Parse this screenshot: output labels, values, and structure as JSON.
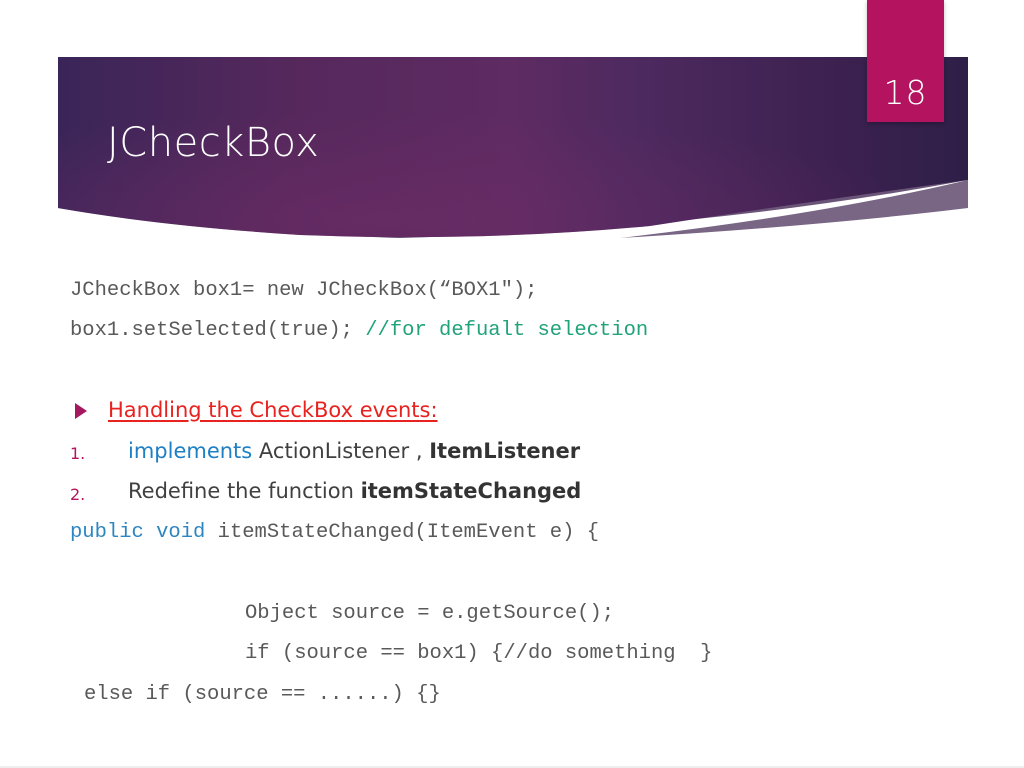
{
  "slide": {
    "number": "18",
    "title": "JCheckBox"
  },
  "code_block_1": {
    "line1": "JCheckBox box1= new JCheckBox(“BOX1\");",
    "line2_code": "box1.setSelected(true); ",
    "line2_comment": "//for defualt selection"
  },
  "section": {
    "heading": "Handling the CheckBox events:",
    "items": [
      {
        "number": "1.",
        "keyword": "implements",
        "text": " ActionListener , ",
        "bold": "ItemListener"
      },
      {
        "number": "2.",
        "text": "Redefine the function ",
        "bold": "itemStateChanged"
      }
    ]
  },
  "code_block_2": {
    "sig_kw1": "public",
    "sig_kw2": "void",
    "sig_rest": " itemStateChanged(ItemEvent e) {",
    "line_obj": "Object source = e.getSource();",
    "line_if": "if (source == box1) {//do something  }",
    "line_else": "else if (source == ......) {}"
  },
  "colors": {
    "banner_dark": "#2e1f4d",
    "banner_mid": "#5c2a5e",
    "slide_number_bg": "#b3135f",
    "heading_red": "#e8221f",
    "keyword_blue": "#1e7fc4",
    "comment_green": "#21a37a",
    "bullet_magenta": "#a3185f"
  }
}
